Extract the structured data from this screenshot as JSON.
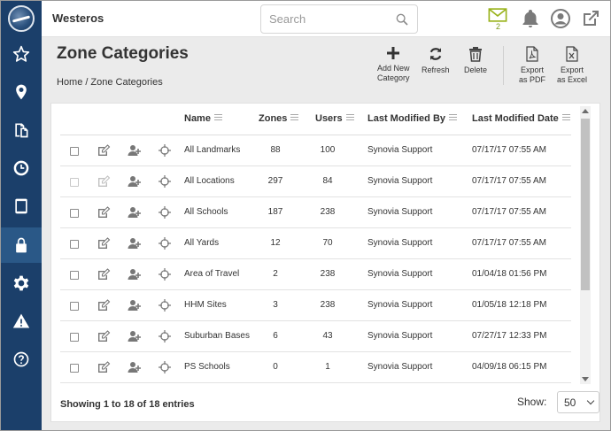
{
  "app": {
    "name": "Westeros"
  },
  "search": {
    "placeholder": "Search"
  },
  "header": {
    "notification_count": "2",
    "icons": [
      "mail-icon",
      "bell-icon",
      "user-icon",
      "external-link-icon"
    ]
  },
  "sidebar": {
    "items": [
      {
        "icon": "star-icon"
      },
      {
        "icon": "map-pin-icon"
      },
      {
        "icon": "documents-icon"
      },
      {
        "icon": "clock-icon"
      },
      {
        "icon": "tablet-icon"
      },
      {
        "icon": "lock-icon",
        "active": true
      },
      {
        "icon": "gear-icon"
      },
      {
        "icon": "warning-icon"
      },
      {
        "icon": "help-icon"
      }
    ]
  },
  "page": {
    "title": "Zone Categories",
    "breadcrumb": [
      "Home",
      "/",
      "Zone Categories"
    ]
  },
  "toolbar": {
    "add_line1": "Add New",
    "add_line2": "Category",
    "refresh": "Refresh",
    "delete": "Delete",
    "pdf_line1": "Export",
    "pdf_line2": "as PDF",
    "excel_line1": "Export",
    "excel_line2": "as Excel"
  },
  "table": {
    "columns": [
      "Name",
      "Zones",
      "Users",
      "Last Modified By",
      "Last Modified Date"
    ],
    "rows": [
      {
        "name": "All Landmarks",
        "zones": "88",
        "users": "100",
        "modified_by": "Synovia Support",
        "modified_date": "07/17/17 07:55 AM",
        "disabled": false
      },
      {
        "name": "All Locations",
        "zones": "297",
        "users": "84",
        "modified_by": "Synovia Support",
        "modified_date": "07/17/17 07:55 AM",
        "disabled": true
      },
      {
        "name": "All Schools",
        "zones": "187",
        "users": "238",
        "modified_by": "Synovia Support",
        "modified_date": "07/17/17 07:55 AM",
        "disabled": false
      },
      {
        "name": "All Yards",
        "zones": "12",
        "users": "70",
        "modified_by": "Synovia Support",
        "modified_date": "07/17/17 07:55 AM",
        "disabled": false
      },
      {
        "name": "Area of Travel",
        "zones": "2",
        "users": "238",
        "modified_by": "Synovia Support",
        "modified_date": "01/04/18 01:56 PM",
        "disabled": false
      },
      {
        "name": "HHM Sites",
        "zones": "3",
        "users": "238",
        "modified_by": "Synovia Support",
        "modified_date": "01/05/18 12:18 PM",
        "disabled": false
      },
      {
        "name": "Suburban Bases",
        "zones": "6",
        "users": "43",
        "modified_by": "Synovia Support",
        "modified_date": "07/27/17 12:33 PM",
        "disabled": false
      },
      {
        "name": "PS Schools",
        "zones": "0",
        "users": "1",
        "modified_by": "Synovia Support",
        "modified_date": "04/09/18 06:15 PM",
        "disabled": false
      }
    ]
  },
  "footer": {
    "info": "Showing 1 to 18 of 18 entries",
    "show_label": "Show:",
    "page_size": "50"
  },
  "colors": {
    "sidebar": "#1b3f6a",
    "active_nav": "#2a5887",
    "mail_accent": "#9ab31c"
  }
}
